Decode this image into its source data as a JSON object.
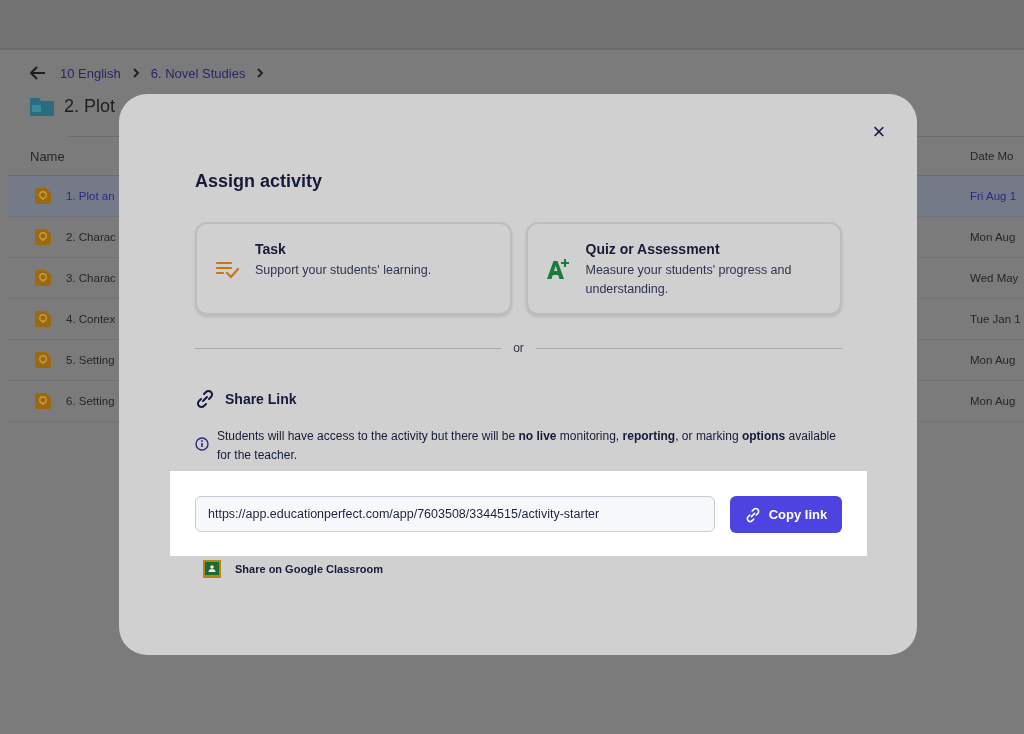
{
  "breadcrumb": [
    {
      "label": "10 English"
    },
    {
      "label": "6. Novel Studies"
    }
  ],
  "page_title": "2. Plot",
  "table": {
    "columns": [
      "Name",
      "Date Mo"
    ],
    "rows": [
      {
        "name": "1. Plot an",
        "date": "Fri Aug 1",
        "selected": true
      },
      {
        "name": "2. Charac",
        "date": "Mon Aug",
        "selected": false
      },
      {
        "name": "3. Charac",
        "date": "Wed May",
        "selected": false
      },
      {
        "name": "4. Contex",
        "date": "Tue Jan 1",
        "selected": false
      },
      {
        "name": "5. Setting",
        "date": "Mon Aug",
        "selected": false
      },
      {
        "name": "6. Setting",
        "date": "Mon Aug",
        "selected": false
      }
    ]
  },
  "dialog": {
    "title": "Assign activity",
    "close": "×",
    "options": [
      {
        "kind": "task",
        "title": "Task",
        "description": "Support your students' learning."
      },
      {
        "kind": "quiz",
        "title": "Quiz or Assessment",
        "description": "Measure your students' progress and understanding."
      }
    ],
    "divider": "or",
    "share_title": "Share Link",
    "notice": "Students will have access to the activity but there will be **no live** monitoring, **reporting**, or marking **options** available for the teacher.",
    "link_value": "https://app.educationperfect.com/app/7603508/3344515/activity-starter",
    "copy_button": "Copy link",
    "classroom_link": "Share on Google Classroom"
  }
}
